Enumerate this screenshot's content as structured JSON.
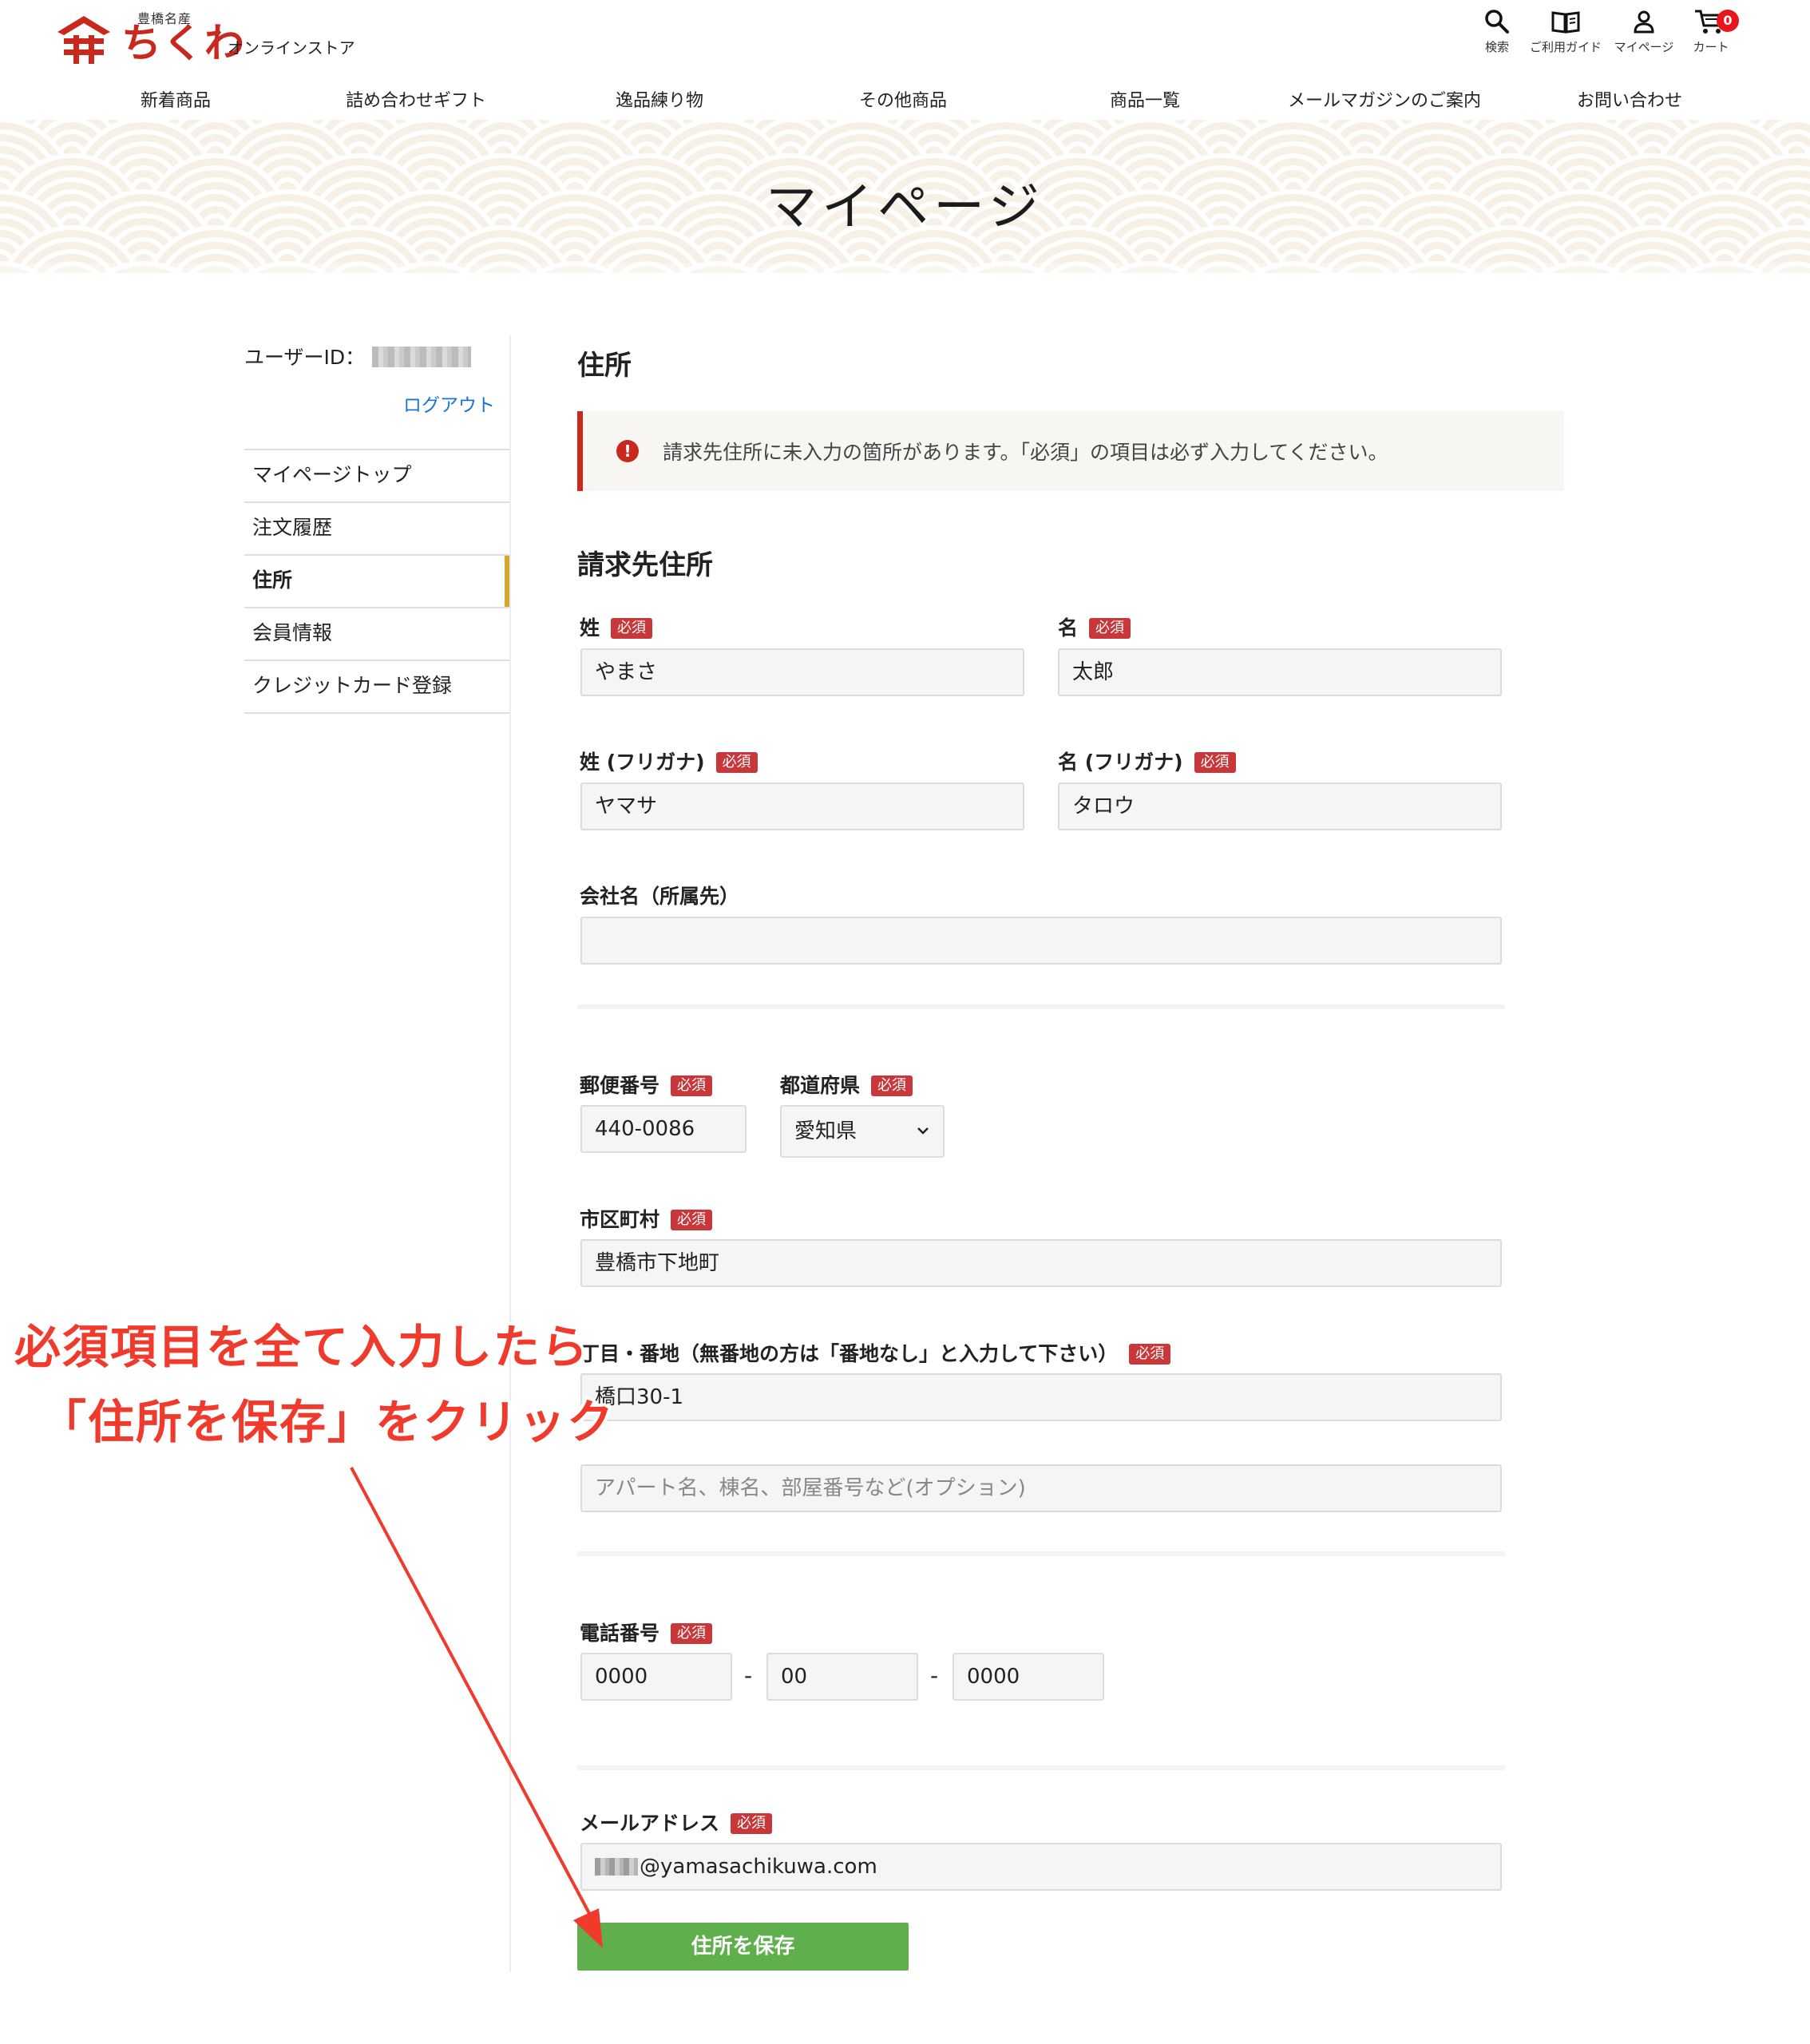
{
  "brand": {
    "small_text": "豊橋名産",
    "main_text": "ちくわ",
    "sub_text": "オンラインストア"
  },
  "header_icons": [
    {
      "label": "検索",
      "icon": "search-icon"
    },
    {
      "label": "ご利用ガイド",
      "icon": "book-icon"
    },
    {
      "label": "マイページ",
      "icon": "user-icon"
    },
    {
      "label": "カート",
      "icon": "cart-icon",
      "badge": "0"
    }
  ],
  "nav": [
    "新着商品",
    "詰め合わせギフト",
    "逸品練り物",
    "その他商品",
    "商品一覧",
    "メールマガジンのご案内",
    "お問い合わせ"
  ],
  "banner": {
    "title": "マイページ"
  },
  "sidebar": {
    "userid_label": "ユーザーID：",
    "logout": "ログアウト",
    "items": [
      "マイページトップ",
      "注文履歴",
      "住所",
      "会員情報",
      "クレジットカード登録"
    ],
    "active_index": 2
  },
  "main": {
    "title": "住所",
    "alert": "請求先住所に未入力の箇所があります。「必須」の項目は必ず入力してください。",
    "section_title": "請求先住所",
    "required_badge": "必須",
    "fields": {
      "last_name": {
        "label": "姓",
        "value": "やまさ"
      },
      "first_name": {
        "label": "名",
        "value": "太郎"
      },
      "last_kana": {
        "label": "姓 (フリガナ)",
        "value": "ヤマサ"
      },
      "first_kana": {
        "label": "名 (フリガナ)",
        "value": "タロウ"
      },
      "company": {
        "label": "会社名（所属先）",
        "value": ""
      },
      "postal": {
        "label": "郵便番号",
        "value": "440-0086"
      },
      "prefecture": {
        "label": "都道府県",
        "value": "愛知県"
      },
      "city": {
        "label": "市区町村",
        "value": "豊橋市下地町"
      },
      "street": {
        "label": "丁目・番地（無番地の方は「番地なし」と入力して下さい）",
        "value": "橋口30-1"
      },
      "building": {
        "placeholder": "アパート名、棟名、部屋番号など(オプション)",
        "value": ""
      },
      "phone": {
        "label": "電話番号",
        "part1": "0000",
        "part2": "00",
        "part3": "0000",
        "separator": "-"
      },
      "email": {
        "label": "メールアドレス",
        "value": "@yamasachikuwa.com"
      }
    },
    "save_button": "住所を保存"
  },
  "annotation": {
    "line1": "必須項目を全て入力したら",
    "line2": "「住所を保存」をクリック",
    "color": "#ef3a2c"
  }
}
